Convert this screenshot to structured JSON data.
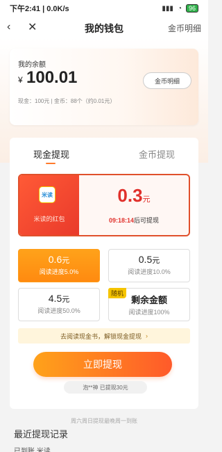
{
  "status": {
    "time_speed": "下午2:41 | 0.0K/s",
    "signal": "▮▮▮",
    "wifi": "◔",
    "battery": "96"
  },
  "nav": {
    "title": "我的钱包",
    "right_link": "金币明细"
  },
  "balance": {
    "label": "我的余额",
    "currency": "¥",
    "amount": "100.01",
    "sub": "现金：100元   |   金币：88个（约0.01元）",
    "detail_button": "金币明细"
  },
  "tabs": {
    "cash": "现金提现",
    "coin": "金币提现"
  },
  "red_packet": {
    "app_icon_text": "米读",
    "label": "米读的红包",
    "amount": "0.3",
    "unit": "元",
    "countdown": "09:18:14",
    "countdown_suffix": "后可提现"
  },
  "options": [
    {
      "value": "0.6",
      "unit": "元",
      "progress": "阅读进度5.0%"
    },
    {
      "value": "0.5",
      "unit": "元",
      "progress": "阅读进度10.0%"
    },
    {
      "value": "4.5",
      "unit": "元",
      "progress": "阅读进度50.0%"
    },
    {
      "badge": "随机",
      "value": "剩余金额",
      "progress": "阅读进度100%"
    }
  ],
  "unlock_bar": {
    "text": "去阅读现金书，解锁现金提现",
    "arrow": "›"
  },
  "cta": "立即提现",
  "ticker": "泡**神 已提现30元",
  "note": "周六周日提现最晚周一到账",
  "recent_title": "最近提现记录",
  "recent_cut": "已到账 米读 ..."
}
